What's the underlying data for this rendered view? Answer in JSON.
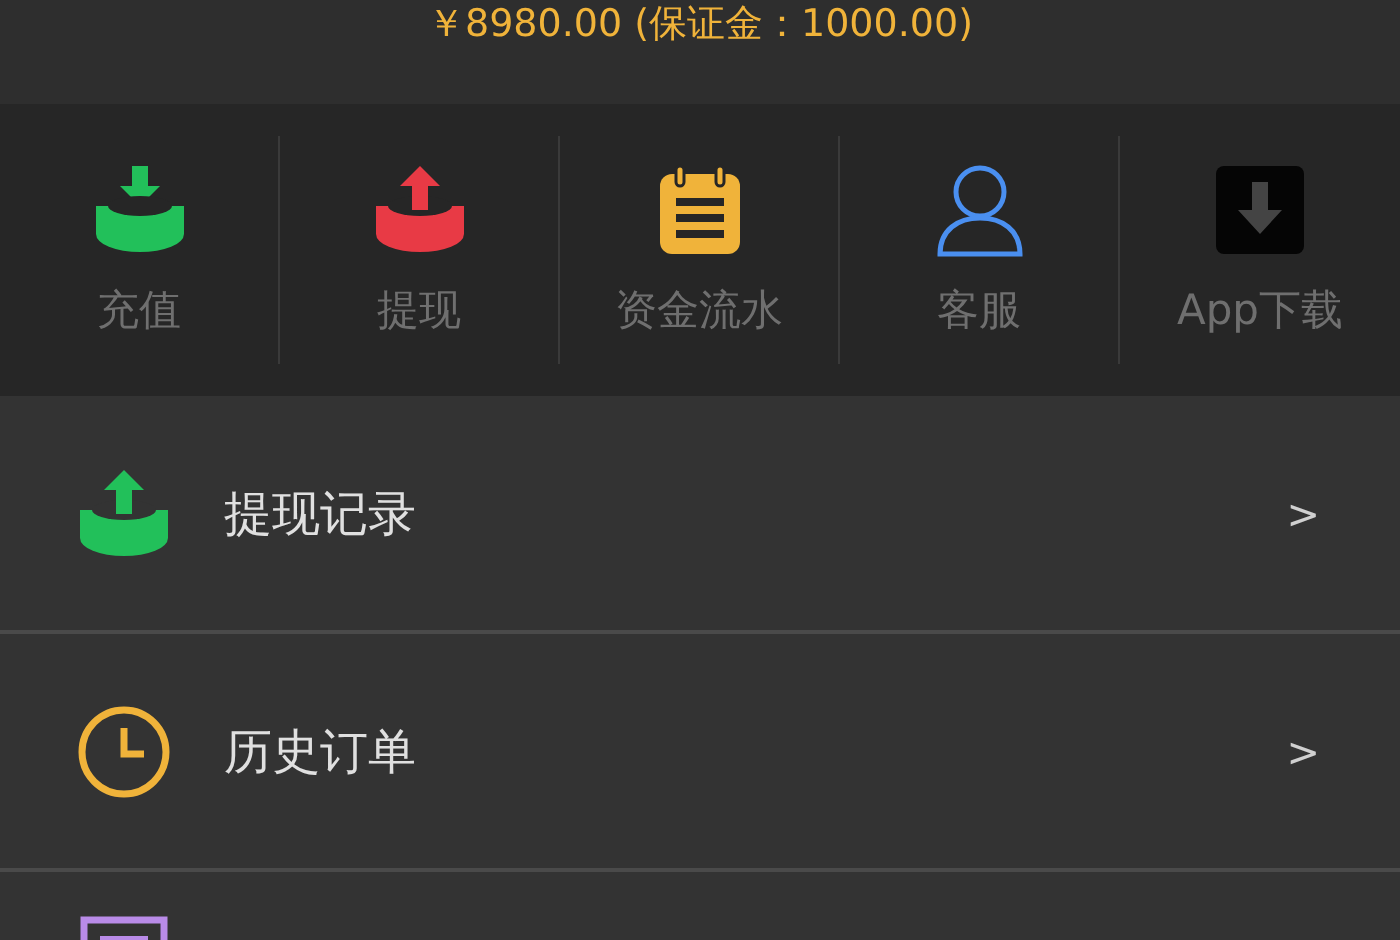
{
  "balance": "￥8980.00 (保证金：1000.00)",
  "shortcuts": [
    {
      "kind": "deposit",
      "label": "充值"
    },
    {
      "kind": "withdraw",
      "label": "提现"
    },
    {
      "kind": "ledger",
      "label": "资金流水"
    },
    {
      "kind": "service",
      "label": "客服"
    },
    {
      "kind": "download",
      "label": "App下载"
    }
  ],
  "menu": [
    {
      "kind": "withdraw-record",
      "label": "提现记录",
      "arrow": ">"
    },
    {
      "kind": "history",
      "label": "历史订单",
      "arrow": ">"
    },
    {
      "kind": "document"
    }
  ]
}
